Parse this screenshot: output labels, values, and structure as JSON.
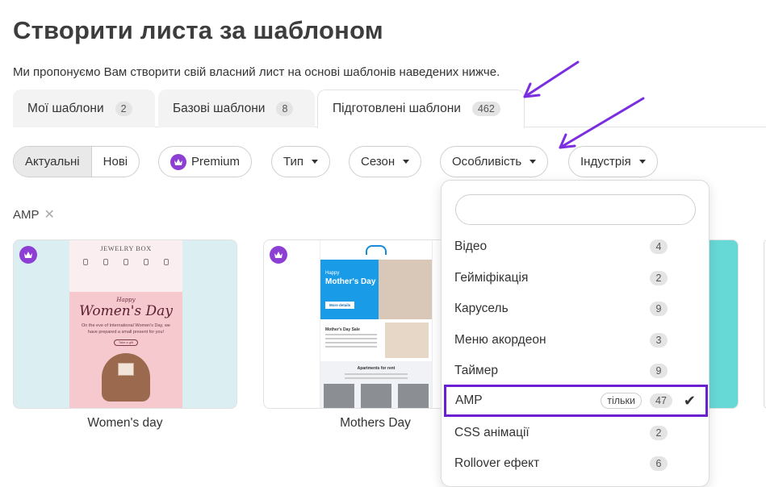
{
  "page": {
    "title": "Створити листа за шаблоном",
    "subtitle": "Ми пропонуємо Вам створити свій власний лист на основі шаблонів наведених нижче."
  },
  "tabs": [
    {
      "label": "Мої шаблони",
      "count": "2"
    },
    {
      "label": "Базові шаблони",
      "count": "8"
    },
    {
      "label": "Підготовлені шаблони",
      "count": "462",
      "active": true
    }
  ],
  "filters": {
    "segment": [
      "Актуальні",
      "Нові"
    ],
    "premium": "Premium",
    "type": "Тип",
    "season": "Сезон",
    "feature": "Особливість",
    "industry": "Індустрія"
  },
  "active_tag": "AMP",
  "cards": [
    {
      "caption": "Women's day",
      "preview": {
        "brand": "JEWELRY BOX",
        "happy": "Happy",
        "headline": "Women's Day",
        "body": "On the eve of International Women's Day, we have prepared a small present for you!",
        "button": "Take a gift"
      }
    },
    {
      "caption": "Mothers Day",
      "preview": {
        "happy": "Happy",
        "headline": "Mother's Day",
        "button": "More details",
        "sale_title": "Mother's Day Sale",
        "rent_title": "Apartments for rent"
      }
    }
  ],
  "dropdown": {
    "search_value": "",
    "items": [
      {
        "label": "Відео",
        "count": "4"
      },
      {
        "label": "Гейміфікація",
        "count": "2"
      },
      {
        "label": "Карусель",
        "count": "9"
      },
      {
        "label": "Меню акордеон",
        "count": "3"
      },
      {
        "label": "Таймер",
        "count": "9"
      },
      {
        "label": "AMP",
        "count": "47",
        "only": "тільки",
        "selected": true
      },
      {
        "label": "CSS анімації",
        "count": "2"
      },
      {
        "label": "Rollover ефект",
        "count": "6"
      }
    ]
  },
  "colors": {
    "accent": "#8d3fd4",
    "highlight": "#6a1fd1",
    "arrow": "#7b2ee0"
  }
}
